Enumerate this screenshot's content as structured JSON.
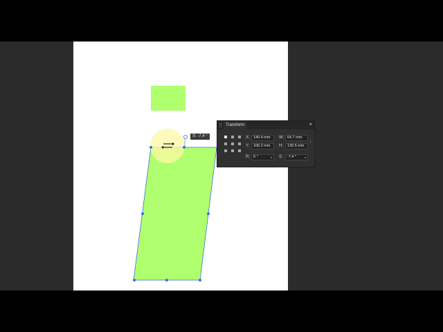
{
  "colors": {
    "shape_fill": "#b0ff6e",
    "selection": "#3b6fd8",
    "highlight": "#fff7a8",
    "panel_bg": "#303030",
    "workspace": "#2b2b2b"
  },
  "canvas": {
    "skew_tooltip": "S: -7.4 °",
    "cursor_icon": "skew-arrows-icon"
  },
  "transform_panel": {
    "title": "Transform",
    "close_icon": "close-icon",
    "x_label": "X:",
    "x_value": "140.4 mm",
    "w_label": "W:",
    "w_value": "64.7 mm",
    "y_label": "Y:",
    "y_value": "106.2 mm",
    "h_label": "H:",
    "h_value": "130.5 mm",
    "r_label": "R:",
    "r_value": "0 °",
    "s_label": "S:",
    "s_value": "-7.4 °"
  }
}
